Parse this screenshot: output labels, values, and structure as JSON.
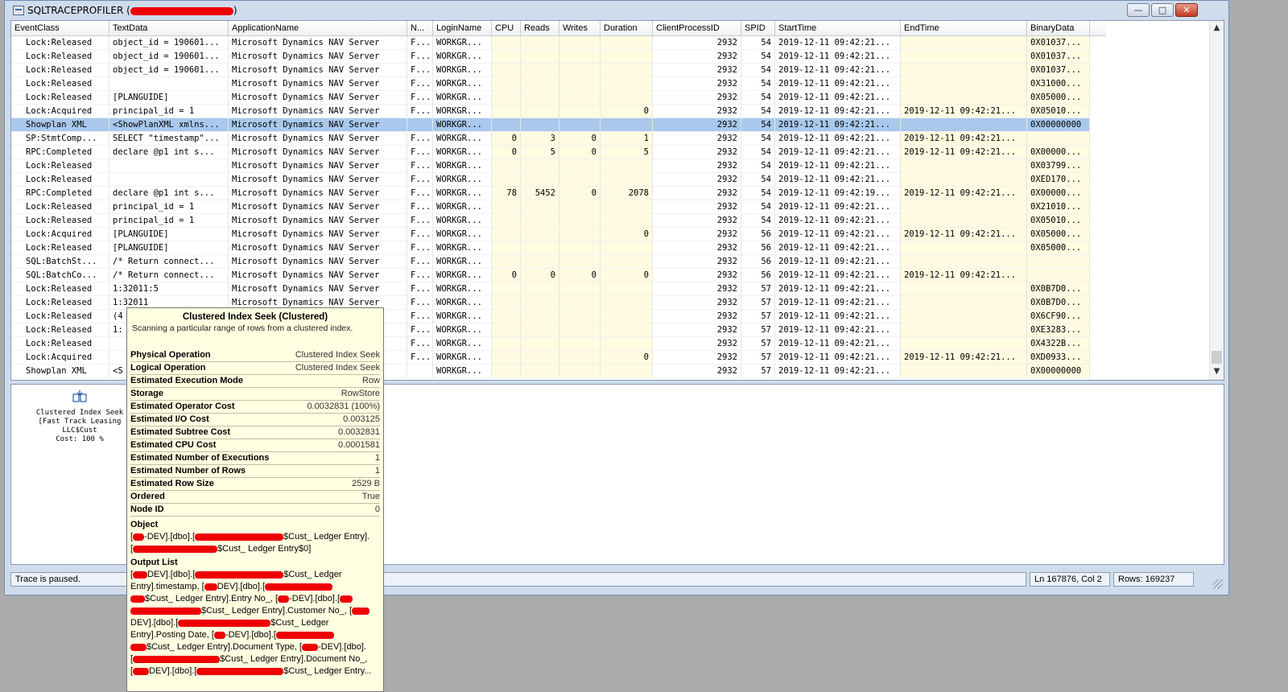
{
  "window": {
    "title": "SQLTRACEPROFILER (",
    "title_suffix": ")",
    "controls": {
      "minimize": "—",
      "maximize": "□",
      "close": "✕"
    }
  },
  "grid": {
    "columns": [
      "EventClass",
      "TextData",
      "ApplicationName",
      "N...",
      "LoginName",
      "CPU",
      "Reads",
      "Writes",
      "Duration",
      "ClientProcessID",
      "SPID",
      "StartTime",
      "EndTime",
      "BinaryData"
    ],
    "rows": [
      {
        "ev": "Lock:Released",
        "td": "object_id = 190601...",
        "app": "Microsoft Dynamics NAV Server",
        "n": "F...",
        "login": "WORKGR...",
        "cpu": "",
        "reads": "",
        "writes": "",
        "dur": "",
        "cpid": "2932",
        "spid": "54",
        "start": "2019-12-11 09:42:21...",
        "end": "",
        "bin": "0X01037..."
      },
      {
        "ev": "Lock:Released",
        "td": "object_id = 190601...",
        "app": "Microsoft Dynamics NAV Server",
        "n": "F...",
        "login": "WORKGR...",
        "cpu": "",
        "reads": "",
        "writes": "",
        "dur": "",
        "cpid": "2932",
        "spid": "54",
        "start": "2019-12-11 09:42:21...",
        "end": "",
        "bin": "0X01037..."
      },
      {
        "ev": "Lock:Released",
        "td": "object_id = 190601...",
        "app": "Microsoft Dynamics NAV Server",
        "n": "F...",
        "login": "WORKGR...",
        "cpu": "",
        "reads": "",
        "writes": "",
        "dur": "",
        "cpid": "2932",
        "spid": "54",
        "start": "2019-12-11 09:42:21...",
        "end": "",
        "bin": "0X01037..."
      },
      {
        "ev": "Lock:Released",
        "td": "",
        "app": "Microsoft Dynamics NAV Server",
        "n": "F...",
        "login": "WORKGR...",
        "cpu": "",
        "reads": "",
        "writes": "",
        "dur": "",
        "cpid": "2932",
        "spid": "54",
        "start": "2019-12-11 09:42:21...",
        "end": "",
        "bin": "0X31000..."
      },
      {
        "ev": "Lock:Released",
        "td": "[PLANGUIDE]",
        "app": "Microsoft Dynamics NAV Server",
        "n": "F...",
        "login": "WORKGR...",
        "cpu": "",
        "reads": "",
        "writes": "",
        "dur": "",
        "cpid": "2932",
        "spid": "54",
        "start": "2019-12-11 09:42:21...",
        "end": "",
        "bin": "0X05000..."
      },
      {
        "ev": "Lock:Acquired",
        "td": "principal_id = 1",
        "app": "Microsoft Dynamics NAV Server",
        "n": "F...",
        "login": "WORKGR...",
        "cpu": "",
        "reads": "",
        "writes": "",
        "dur": "0",
        "cpid": "2932",
        "spid": "54",
        "start": "2019-12-11 09:42:21...",
        "end": "2019-12-11 09:42:21...",
        "bin": "0X05010..."
      },
      {
        "ev": "Showplan XML",
        "td": "<ShowPlanXML xmlns...",
        "app": "Microsoft Dynamics NAV Server",
        "n": "",
        "login": "WORKGR...",
        "cpu": "",
        "reads": "",
        "writes": "",
        "dur": "",
        "cpid": "2932",
        "spid": "54",
        "start": "2019-12-11 09:42:21...",
        "end": "",
        "bin": "0X00000000",
        "selected": true
      },
      {
        "ev": "SP:StmtComp...",
        "td": "SELECT \"timestamp\"...",
        "app": "Microsoft Dynamics NAV Server",
        "n": "F...",
        "login": "WORKGR...",
        "cpu": "0",
        "reads": "3",
        "writes": "0",
        "dur": "1",
        "cpid": "2932",
        "spid": "54",
        "start": "2019-12-11 09:42:21...",
        "end": "2019-12-11 09:42:21...",
        "bin": ""
      },
      {
        "ev": "RPC:Completed",
        "td": "declare @p1 int  s...",
        "app": "Microsoft Dynamics NAV Server",
        "n": "F...",
        "login": "WORKGR...",
        "cpu": "0",
        "reads": "5",
        "writes": "0",
        "dur": "5",
        "cpid": "2932",
        "spid": "54",
        "start": "2019-12-11 09:42:21...",
        "end": "2019-12-11 09:42:21...",
        "bin": "0X00000..."
      },
      {
        "ev": "Lock:Released",
        "td": "",
        "app": "Microsoft Dynamics NAV Server",
        "n": "F...",
        "login": "WORKGR...",
        "cpu": "",
        "reads": "",
        "writes": "",
        "dur": "",
        "cpid": "2932",
        "spid": "54",
        "start": "2019-12-11 09:42:21...",
        "end": "",
        "bin": "0X03799..."
      },
      {
        "ev": "Lock:Released",
        "td": "",
        "app": "Microsoft Dynamics NAV Server",
        "n": "F...",
        "login": "WORKGR...",
        "cpu": "",
        "reads": "",
        "writes": "",
        "dur": "",
        "cpid": "2932",
        "spid": "54",
        "start": "2019-12-11 09:42:21...",
        "end": "",
        "bin": "0XED170..."
      },
      {
        "ev": "RPC:Completed",
        "td": "declare @p1 int  s...",
        "app": "Microsoft Dynamics NAV Server",
        "n": "F...",
        "login": "WORKGR...",
        "cpu": "78",
        "reads": "5452",
        "writes": "0",
        "dur": "2078",
        "cpid": "2932",
        "spid": "54",
        "start": "2019-12-11 09:42:19...",
        "end": "2019-12-11 09:42:21...",
        "bin": "0X00000..."
      },
      {
        "ev": "Lock:Released",
        "td": "principal_id = 1",
        "app": "Microsoft Dynamics NAV Server",
        "n": "F...",
        "login": "WORKGR...",
        "cpu": "",
        "reads": "",
        "writes": "",
        "dur": "",
        "cpid": "2932",
        "spid": "54",
        "start": "2019-12-11 09:42:21...",
        "end": "",
        "bin": "0X21010..."
      },
      {
        "ev": "Lock:Released",
        "td": "principal_id = 1",
        "app": "Microsoft Dynamics NAV Server",
        "n": "F...",
        "login": "WORKGR...",
        "cpu": "",
        "reads": "",
        "writes": "",
        "dur": "",
        "cpid": "2932",
        "spid": "54",
        "start": "2019-12-11 09:42:21...",
        "end": "",
        "bin": "0X05010..."
      },
      {
        "ev": "Lock:Acquired",
        "td": "[PLANGUIDE]",
        "app": "Microsoft Dynamics NAV Server",
        "n": "F...",
        "login": "WORKGR...",
        "cpu": "",
        "reads": "",
        "writes": "",
        "dur": "0",
        "cpid": "2932",
        "spid": "56",
        "start": "2019-12-11 09:42:21...",
        "end": "2019-12-11 09:42:21...",
        "bin": "0X05000..."
      },
      {
        "ev": "Lock:Released",
        "td": "[PLANGUIDE]",
        "app": "Microsoft Dynamics NAV Server",
        "n": "F...",
        "login": "WORKGR...",
        "cpu": "",
        "reads": "",
        "writes": "",
        "dur": "",
        "cpid": "2932",
        "spid": "56",
        "start": "2019-12-11 09:42:21...",
        "end": "",
        "bin": "0X05000..."
      },
      {
        "ev": "SQL:BatchSt...",
        "td": "/*  Return connect...",
        "app": "Microsoft Dynamics NAV Server",
        "n": "F...",
        "login": "WORKGR...",
        "cpu": "",
        "reads": "",
        "writes": "",
        "dur": "",
        "cpid": "2932",
        "spid": "56",
        "start": "2019-12-11 09:42:21...",
        "end": "",
        "bin": ""
      },
      {
        "ev": "SQL:BatchCo...",
        "td": "/*  Return connect...",
        "app": "Microsoft Dynamics NAV Server",
        "n": "F...",
        "login": "WORKGR...",
        "cpu": "0",
        "reads": "0",
        "writes": "0",
        "dur": "0",
        "cpid": "2932",
        "spid": "56",
        "start": "2019-12-11 09:42:21...",
        "end": "2019-12-11 09:42:21...",
        "bin": ""
      },
      {
        "ev": "Lock:Released",
        "td": "1:32011:5",
        "app": "Microsoft Dynamics NAV Server",
        "n": "F...",
        "login": "WORKGR...",
        "cpu": "",
        "reads": "",
        "writes": "",
        "dur": "",
        "cpid": "2932",
        "spid": "57",
        "start": "2019-12-11 09:42:21...",
        "end": "",
        "bin": "0X0B7D0..."
      },
      {
        "ev": "Lock:Released",
        "td": "1:32011",
        "app": "Microsoft Dynamics NAV Server",
        "n": "F...",
        "login": "WORKGR...",
        "cpu": "",
        "reads": "",
        "writes": "",
        "dur": "",
        "cpid": "2932",
        "spid": "57",
        "start": "2019-12-11 09:42:21...",
        "end": "",
        "bin": "0X0B7D0..."
      },
      {
        "ev": "Lock:Released",
        "td": "(4",
        "app": "r",
        "n": "F...",
        "login": "WORKGR...",
        "cpu": "",
        "reads": "",
        "writes": "",
        "dur": "",
        "cpid": "2932",
        "spid": "57",
        "start": "2019-12-11 09:42:21...",
        "end": "",
        "bin": "0X6CF90..."
      },
      {
        "ev": "Lock:Released",
        "td": "1:",
        "app": "r",
        "n": "F...",
        "login": "WORKGR...",
        "cpu": "",
        "reads": "",
        "writes": "",
        "dur": "",
        "cpid": "2932",
        "spid": "57",
        "start": "2019-12-11 09:42:21...",
        "end": "",
        "bin": "0XE3283..."
      },
      {
        "ev": "Lock:Released",
        "td": "",
        "app": "r",
        "n": "F...",
        "login": "WORKGR...",
        "cpu": "",
        "reads": "",
        "writes": "",
        "dur": "",
        "cpid": "2932",
        "spid": "57",
        "start": "2019-12-11 09:42:21...",
        "end": "",
        "bin": "0X4322B..."
      },
      {
        "ev": "Lock:Acquired",
        "td": "",
        "app": "r",
        "n": "F...",
        "login": "WORKGR...",
        "cpu": "",
        "reads": "",
        "writes": "",
        "dur": "0",
        "cpid": "2932",
        "spid": "57",
        "start": "2019-12-11 09:42:21...",
        "end": "2019-12-11 09:42:21...",
        "bin": "0XD0933..."
      },
      {
        "ev": "Showplan XML",
        "td": "<S",
        "app": "r",
        "n": "",
        "login": "WORKGR...",
        "cpu": "",
        "reads": "",
        "writes": "",
        "dur": "",
        "cpid": "2932",
        "spid": "57",
        "start": "2019-12-11 09:42:21...",
        "end": "",
        "bin": "0X00000000"
      }
    ]
  },
  "plan": {
    "op_name": "Clustered Index Seek",
    "op_object": "[Fast Track Leasing LLC$Cust",
    "op_cost": "Cost: 100 %"
  },
  "tooltip": {
    "title": "Clustered Index Seek (Clustered)",
    "description": "Scanning a particular range of rows from a clustered index.",
    "properties": [
      {
        "k": "Physical Operation",
        "v": "Clustered Index Seek"
      },
      {
        "k": "Logical Operation",
        "v": "Clustered Index Seek"
      },
      {
        "k": "Estimated Execution Mode",
        "v": "Row"
      },
      {
        "k": "Storage",
        "v": "RowStore"
      },
      {
        "k": "Estimated Operator Cost",
        "v": "0.0032831 (100%)"
      },
      {
        "k": "Estimated I/O Cost",
        "v": "0.003125"
      },
      {
        "k": "Estimated Subtree Cost",
        "v": "0.0032831"
      },
      {
        "k": "Estimated CPU Cost",
        "v": "0.0001581"
      },
      {
        "k": "Estimated Number of Executions",
        "v": "1"
      },
      {
        "k": "Estimated Number of Rows",
        "v": "1"
      },
      {
        "k": "Estimated Row Size",
        "v": "2529 B"
      },
      {
        "k": "Ordered",
        "v": "True"
      },
      {
        "k": "Node ID",
        "v": "0"
      }
    ],
    "object_heading": "Object",
    "object_lines": [
      "-DEV].[dbo].[",
      "$Cust_ Ledger Entry].",
      "$Cust_ Ledger Entry$0]"
    ],
    "output_heading": "Output List",
    "output_lines": [
      "DEV].[dbo].[",
      "$Cust_ Ledger",
      "Entry].timestamp, [",
      "DEV].[dbo].[",
      "$Cust_ Ledger Entry].Entry No_, [",
      "-DEV].[dbo].[",
      "$Cust_ Ledger Entry].Customer No_, [",
      "DEV].[dbo].[",
      "$Cust_ Ledger",
      "Entry].Posting Date, [",
      "-DEV].[dbo].[",
      "$Cust_ Ledger Entry].Document Type, [",
      "-DEV].[dbo].",
      "$Cust_ Ledger Entry].Document No_,",
      "DEV].[dbo].[",
      "$Cust_ Ledger Entry..."
    ]
  },
  "status": {
    "message": "Trace is paused.",
    "position": "Ln 167876, Col 2",
    "rows": "Rows: 169237"
  }
}
